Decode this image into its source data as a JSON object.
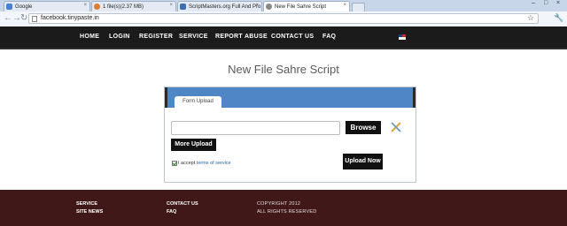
{
  "browser": {
    "tabs": [
      {
        "label": "Google",
        "active": false,
        "fav_color": "#4a7fd6"
      },
      {
        "label": "1 file(s)(2.37 MB)",
        "active": false,
        "fav_color": "#e07b2d"
      },
      {
        "label": "ScriptMasters.org Full And Pro",
        "active": false,
        "fav_color": "#3b6fb0"
      },
      {
        "label": "New File Sahre Script",
        "active": true,
        "fav_color": "#888888"
      }
    ],
    "url": "facebook.tinypaste.in",
    "back_glyph": "←",
    "forward_glyph": "→",
    "reload_glyph": "↻",
    "star_glyph": "☆",
    "wrench_glyph": "🔧",
    "close_glyph": "×",
    "minimize_glyph": "–",
    "maximize_glyph": "□"
  },
  "nav": {
    "items": [
      "HOME",
      "LOGIN",
      "REGISTER",
      "SERVICE",
      "REPORT ABUSE",
      "CONTACT US",
      "FAQ"
    ]
  },
  "main": {
    "title": "New File Sahre Script",
    "form_tab": "Form Upload",
    "browse": "Browse",
    "more_upload": "More Upload",
    "accept_prefix": "I accept",
    "accept_link": "terms of service",
    "accept_checked": true,
    "upload_now": "Upload Now"
  },
  "footer": {
    "col1": [
      "SERVICE",
      "SITE NEWS"
    ],
    "col2": [
      "CONTACT US",
      "FAQ"
    ],
    "copyright": "COPYRIGHT 2012",
    "rights": "ALL RIGHTS RESERVED"
  },
  "colors": {
    "nav_bg": "#1b1b1b",
    "panel_header": "#4e86c6",
    "footer_bg": "#3f1817",
    "button_bg": "#111111",
    "link": "#2266aa"
  }
}
